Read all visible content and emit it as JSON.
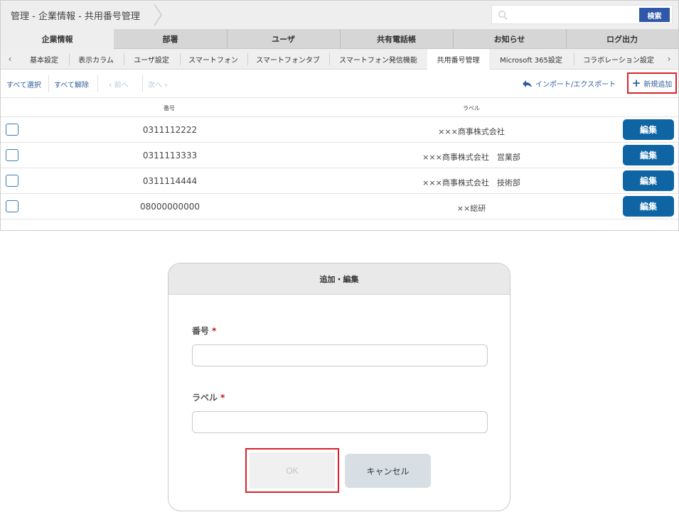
{
  "breadcrumb": {
    "title": "管理 - 企業情報 - 共用番号管理"
  },
  "search": {
    "placeholder": "",
    "button_label": "検索"
  },
  "main_tabs": [
    {
      "label": "企業情報",
      "active": true
    },
    {
      "label": "部署"
    },
    {
      "label": "ユーザ"
    },
    {
      "label": "共有電話帳"
    },
    {
      "label": "お知らせ"
    },
    {
      "label": "ログ出力"
    }
  ],
  "sub_tabs": [
    {
      "label": "基本設定"
    },
    {
      "label": "表示カラム"
    },
    {
      "label": "ユーザ設定"
    },
    {
      "label": "スマートフォン"
    },
    {
      "label": "スマートフォンタブ"
    },
    {
      "label": "スマートフォン発信機能"
    },
    {
      "label": "共用番号管理",
      "active": true
    },
    {
      "label": "Microsoft 365設定"
    },
    {
      "label": "コラボレーション設定"
    }
  ],
  "toolbar": {
    "select_all": "すべて選択",
    "deselect_all": "すべて解除",
    "prev": "前へ",
    "next": "次へ",
    "import_export": "インポート/エクスポート",
    "new_add": "新規追加"
  },
  "table": {
    "columns": {
      "number": "番号",
      "label": "ラベル"
    },
    "edit_label": "編集",
    "rows": [
      {
        "number": "0311112222",
        "label": "×××商事株式会社"
      },
      {
        "number": "0311113333",
        "label": "×××商事株式会社　営業部"
      },
      {
        "number": "0311114444",
        "label": "×××商事株式会社　技術部"
      },
      {
        "number": "08000000000",
        "label": "××総研"
      }
    ]
  },
  "dialog": {
    "title": "追加・編集",
    "number_label": "番号",
    "label_label": "ラベル",
    "required_mark": "*",
    "number_value": "",
    "label_value": "",
    "ok_label": "OK",
    "cancel_label": "キャンセル"
  },
  "colors": {
    "accent": "#2f59a8",
    "edit_button": "#0f65a3",
    "highlight": "#d8232a",
    "link": "#2f5c9c"
  }
}
